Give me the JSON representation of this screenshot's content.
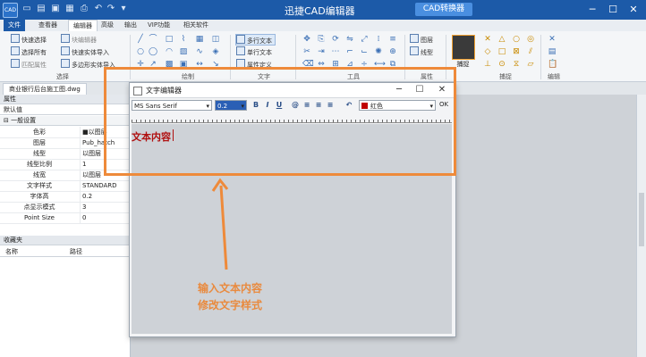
{
  "app": {
    "title": "迅捷CAD编辑器",
    "convert_button": "CAD转换器",
    "logo_text": "CAD"
  },
  "tabs": [
    "文件",
    "查看器",
    "编辑器",
    "高级",
    "输出",
    "VIP功能",
    "相关软件"
  ],
  "ribbon": {
    "select_group": {
      "label": "选择",
      "items": [
        "快速选择",
        "选择所有",
        "匹配属性",
        "块编辑器",
        "快速实体导入",
        "多边形实体导入"
      ]
    },
    "draw_group": {
      "label": "绘制"
    },
    "text_group": {
      "label": "文字",
      "items": [
        "多行文本",
        "单行文本",
        "属性定义"
      ]
    },
    "tools_group": {
      "label": "工具"
    },
    "props_group": {
      "label": "属性",
      "items": [
        "图层",
        "线型"
      ]
    },
    "capture_group": {
      "label": "捕捉",
      "button": "捕捉"
    },
    "edit_group": {
      "label": "编辑"
    }
  },
  "document_tab": "商业银行后台施工图.dwg",
  "properties": {
    "header": "属性",
    "default_value": "默认值",
    "section": "一般设置",
    "rows": [
      {
        "key": "色彩",
        "value": "■以图层"
      },
      {
        "key": "图层",
        "value": "Pub_hatch"
      },
      {
        "key": "线型",
        "value": "以图层"
      },
      {
        "key": "线型比例",
        "value": "1"
      },
      {
        "key": "线宽",
        "value": "以图层"
      },
      {
        "key": "文字样式",
        "value": "STANDARD"
      },
      {
        "key": "字体高",
        "value": "0.2"
      },
      {
        "key": "点显示模式",
        "value": "3"
      },
      {
        "key": "Point Size",
        "value": "0"
      }
    ]
  },
  "favorites": {
    "header": "收藏夹",
    "columns": [
      "名称",
      "路径"
    ]
  },
  "dialog": {
    "title": "文字编辑器",
    "font": "MS Sans Serif",
    "size": "0.2",
    "color": "红色",
    "ok": "OK",
    "content": "文本内容"
  },
  "annotations": [
    "输入文本内容",
    "修改文字样式"
  ],
  "colors": {
    "title_bar": "#1c5aa8",
    "highlight": "#ee8a3a",
    "text_red": "#b01010"
  }
}
